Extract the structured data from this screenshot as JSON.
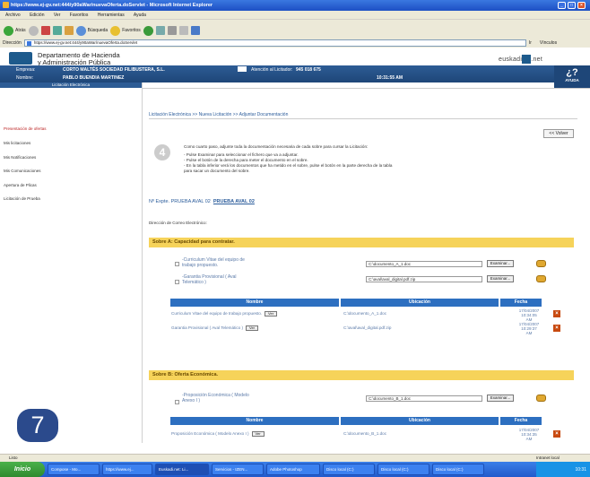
{
  "window": {
    "title": "https://www.ej-gv.net:444/y90aWar/nuevaOferta.doServlet - Microsoft Internet Explorer",
    "menu": [
      "Archivo",
      "Edición",
      "Ver",
      "Favoritos",
      "Herramientas",
      "Ayuda"
    ],
    "toolbar": {
      "back": "Atrás",
      "search": "Búsqueda",
      "favorites": "Favoritos"
    },
    "address_label": "Dirección",
    "address": "https://www.ej-gv.net:444/y90aWar/nuevaOferta.doServlet",
    "go": "Ir",
    "links": "Vínculos"
  },
  "header": {
    "dept_line1": "Departamento de Hacienda",
    "dept_line2": "y Administración Pública",
    "brand": "euskadi",
    "brand_suffix": ".net"
  },
  "infobar": {
    "empresa_label": "Empresa:",
    "empresa_value": "CORTO MALTÉS SOCIEDAD FILIBUSTERA, S.L.",
    "atencion_label": "Atención al Licitador:",
    "atencion_value": "945 018 675",
    "nombre_label": "Nombre:",
    "nombre_value": "PABLO BUENDIA MARTINEZ",
    "time": "10:31:55 AM",
    "ayuda": "AYUDA"
  },
  "sidebar": {
    "header": "Licitación Electrónica",
    "items": [
      "Presentación de ofertas",
      "Mis licitaciones",
      "Mis Notificaciones",
      "Mis Comunicaciones",
      "Apertura de Plicas",
      "Licitación de Prueba"
    ]
  },
  "breadcrumb": "Licitación Electrónica >> Nueva Licitación >> Adjuntar Documentación",
  "volver": "<< Volver",
  "step": {
    "number": "4",
    "intro": "Como cuarto paso, adjunte toda la documentación necesaria de cada sobre para cursar la Licitación:",
    "bullet1": "- Pulse Examinar para seleccionar el fichero que va a adjuntar.",
    "bullet2": "- Pulse el botón de la derecha para meter el documento en el sobre.",
    "bullet3": "- En la tabla inferior verá los documentos que ha metido en el sobre, pulse el botón en la parte derecha de la tabla",
    "bullet4": "para sacar un documento del sobre."
  },
  "expediente": {
    "label": "Nº Expte. PRUEBA AVAL 02",
    "link": "PRUEBA AVAL 02"
  },
  "email_label": "Dirección de Correo Electrónico:",
  "sobre_a": {
    "title": "Sobre A: Capacidad para contratar.",
    "inputs": [
      {
        "label1": "-Curriculum Vitae del equipo de",
        "label2": "trabajo propuesto.",
        "path": "C:\\documento_A_1.doc"
      },
      {
        "label1": "-Garantia Provisional ( Aval",
        "label2": "Telemático )",
        "path": "C:\\aval\\aval_digital.pdf.zip"
      }
    ],
    "examinar": "Examinar...",
    "columns": [
      "Nombre",
      "Ubicación",
      "Fecha"
    ],
    "rows": [
      {
        "nombre": "Curriculum Vitae del equipo de trabajo propuesto.",
        "ver": "Ver",
        "ubicacion": "C:\\documento_A_1.doc",
        "fecha1": "17/04/2007 10:34:05",
        "fecha2": "AM"
      },
      {
        "nombre": "Garantia Provisional ( Aval Telemático )",
        "ver": "Ver",
        "ubicacion": "C:\\aval\\aval_digital.pdf.zip",
        "fecha1": "17/04/2007 10:29:37",
        "fecha2": "AM"
      }
    ]
  },
  "sobre_b": {
    "title": "Sobre B: Oferta Económica.",
    "inputs": [
      {
        "label1": "-Proposición Económica ( Modelo",
        "label2": "Anexo I )",
        "path": "C:\\documento_B_1.doc"
      }
    ],
    "examinar": "Examinar...",
    "columns": [
      "Nombre",
      "Ubicación",
      "Fecha"
    ],
    "rows": [
      {
        "nombre": "Proposición Económica ( Modelo Anexo I )",
        "ver": "Ver",
        "ubicacion": "C:\\documento_B_1.doc",
        "fecha1": "17/04/2007 10:34:35",
        "fecha2": "AM"
      }
    ]
  },
  "badge": "7",
  "statusbar": {
    "left": "Listo",
    "zone": "Intranet local"
  },
  "taskbar": {
    "start": "Inicio",
    "tasks": [
      "Compose - Mo...",
      "https://www.ej...",
      "Euskadi.net: Li...",
      "Servicios - IZEN...",
      "Adobe Photoshop",
      "Disco local (C:)",
      "Disco local (C:)",
      "Disco local (C:)"
    ],
    "clock": "10:31"
  },
  "colors": {
    "accent_blue": "#2d5c95",
    "section_yellow": "#f6d35a",
    "table_head": "#2d6fc0",
    "badge": "#2b4a8c"
  }
}
